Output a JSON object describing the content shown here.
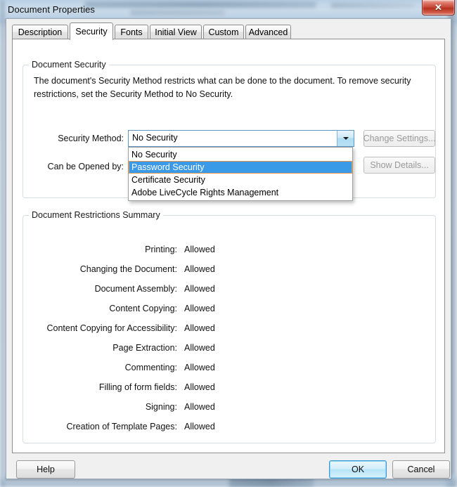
{
  "window": {
    "title": "Document Properties",
    "close_label": "✕"
  },
  "tabs": [
    {
      "label": "Description",
      "active": false
    },
    {
      "label": "Security",
      "active": true
    },
    {
      "label": "Fonts",
      "active": false
    },
    {
      "label": "Initial View",
      "active": false
    },
    {
      "label": "Custom",
      "active": false
    },
    {
      "label": "Advanced",
      "active": false
    }
  ],
  "document_security": {
    "legend": "Document Security",
    "description": "The document's Security Method restricts what can be done to the document. To remove security restrictions, set the Security Method to No Security.",
    "security_method_label": "Security Method:",
    "security_method_value": "No Security",
    "can_be_opened_by_label": "Can be Opened by:",
    "dropdown_open": true,
    "dropdown_options": [
      {
        "label": "No Security",
        "selected": false
      },
      {
        "label": "Password Security",
        "selected": true
      },
      {
        "label": "Certificate Security",
        "selected": false
      },
      {
        "label": "Adobe LiveCycle Rights Management",
        "selected": false
      }
    ],
    "change_settings_label": "Change Settings...",
    "change_settings_enabled": false,
    "show_details_label": "Show Details...",
    "show_details_enabled": false
  },
  "restrictions": {
    "legend": "Document Restrictions Summary",
    "rows": [
      {
        "label": "Printing:",
        "value": "Allowed"
      },
      {
        "label": "Changing the Document:",
        "value": "Allowed"
      },
      {
        "label": "Document Assembly:",
        "value": "Allowed"
      },
      {
        "label": "Content Copying:",
        "value": "Allowed"
      },
      {
        "label": "Content Copying for Accessibility:",
        "value": "Allowed"
      },
      {
        "label": "Page Extraction:",
        "value": "Allowed"
      },
      {
        "label": "Commenting:",
        "value": "Allowed"
      },
      {
        "label": "Filling of form fields:",
        "value": "Allowed"
      },
      {
        "label": "Signing:",
        "value": "Allowed"
      },
      {
        "label": "Creation of Template Pages:",
        "value": "Allowed"
      }
    ]
  },
  "footer": {
    "help_label": "Help",
    "ok_label": "OK",
    "cancel_label": "Cancel"
  },
  "colors": {
    "highlight": "#3b9ae8",
    "close_button": "#c2412f",
    "default_button_border": "#3c9bd4",
    "combo_border": "#5b97c6"
  }
}
